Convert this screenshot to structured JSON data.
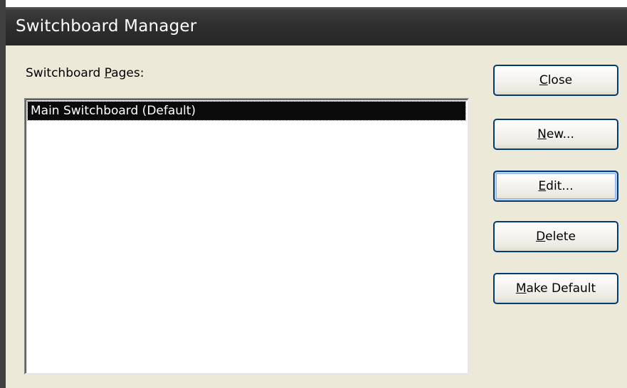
{
  "window": {
    "title": "Switchboard Manager"
  },
  "pages": {
    "label_accel": "P",
    "label_before": "Switchboard ",
    "label_after": "ages:",
    "items": [
      {
        "label": "Main Switchboard (Default)",
        "selected": true
      }
    ]
  },
  "buttons": {
    "close": {
      "accel": "C",
      "rest": "lose"
    },
    "new": {
      "accel": "N",
      "rest": "ew..."
    },
    "edit": {
      "accel": "E",
      "rest": "dit..."
    },
    "delete": {
      "accel": "D",
      "rest": "elete"
    },
    "make_default": {
      "accel": "M",
      "rest": "ake Default"
    }
  },
  "colors": {
    "dialog_bg": "#ece9d8",
    "titlebar": "#2e2e2e",
    "selection_bg": "#0a0a0a",
    "button_border": "#003c74"
  }
}
